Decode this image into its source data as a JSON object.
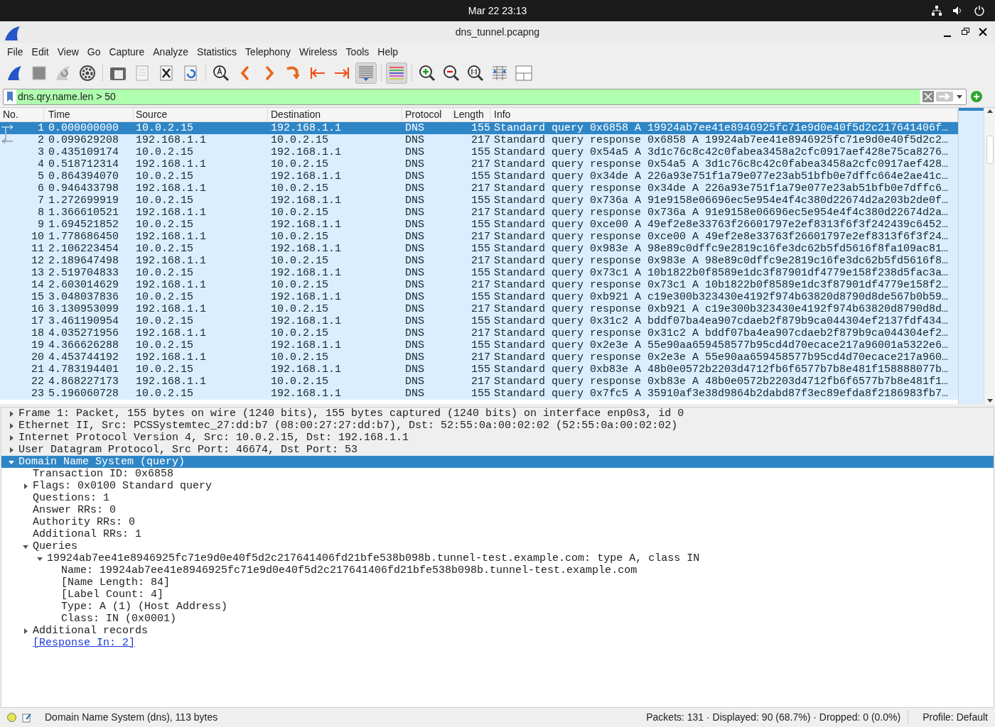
{
  "top_bar": {
    "datetime": "Mar 22  23:13"
  },
  "window": {
    "title": "dns_tunnel.pcapng"
  },
  "menu": [
    "File",
    "Edit",
    "View",
    "Go",
    "Capture",
    "Analyze",
    "Statistics",
    "Telephony",
    "Wireless",
    "Tools",
    "Help"
  ],
  "toolbar": [
    {
      "kind": "start",
      "pressed": false
    },
    {
      "kind": "stop",
      "pressed": false
    },
    {
      "kind": "restart",
      "pressed": false
    },
    {
      "kind": "options",
      "pressed": false
    },
    {
      "kind": "sep"
    },
    {
      "kind": "open",
      "pressed": false
    },
    {
      "kind": "save",
      "pressed": false
    },
    {
      "kind": "close",
      "pressed": false
    },
    {
      "kind": "reload",
      "pressed": false
    },
    {
      "kind": "sep"
    },
    {
      "kind": "find",
      "pressed": false
    },
    {
      "kind": "back",
      "pressed": false
    },
    {
      "kind": "forward",
      "pressed": false
    },
    {
      "kind": "goto",
      "pressed": false
    },
    {
      "kind": "first",
      "pressed": false
    },
    {
      "kind": "last",
      "pressed": false
    },
    {
      "kind": "autoscroll",
      "pressed": true
    },
    {
      "kind": "sep"
    },
    {
      "kind": "colorize",
      "pressed": true
    },
    {
      "kind": "sep"
    },
    {
      "kind": "zoom-in",
      "pressed": false
    },
    {
      "kind": "zoom-out",
      "pressed": false
    },
    {
      "kind": "zoom-normal",
      "pressed": false
    },
    {
      "kind": "resize",
      "pressed": false
    },
    {
      "kind": "layout",
      "pressed": false
    }
  ],
  "filter": {
    "value": "dns.qry.name.len > 50",
    "valid": true
  },
  "packet_list": {
    "columns": [
      "No.",
      "Time",
      "Source",
      "Destination",
      "Protocol",
      "Length",
      "Info"
    ],
    "rows": [
      {
        "no": "1",
        "time": "0.000000000",
        "source": "10.0.2.15",
        "destination": "192.168.1.1",
        "protocol": "DNS",
        "length": "155",
        "info": "Standard query 0x6858 A 19924ab7ee41e8946925fc71e9d0e40f5d2c217641406f…",
        "selected": true,
        "kind": "request"
      },
      {
        "no": "2",
        "time": "0.099629208",
        "source": "192.168.1.1",
        "destination": "10.0.2.15",
        "protocol": "DNS",
        "length": "217",
        "info": "Standard query response 0x6858 A 19924ab7ee41e8946925fc71e9d0e40f5d2c2…",
        "selected": false,
        "kind": "response"
      },
      {
        "no": "3",
        "time": "0.435109174",
        "source": "10.0.2.15",
        "destination": "192.168.1.1",
        "protocol": "DNS",
        "length": "155",
        "info": "Standard query 0x54a5 A 3d1c76c8c42c0fabea3458a2cfc0917aef428e75ca8276…",
        "selected": false
      },
      {
        "no": "4",
        "time": "0.518712314",
        "source": "192.168.1.1",
        "destination": "10.0.2.15",
        "protocol": "DNS",
        "length": "217",
        "info": "Standard query response 0x54a5 A 3d1c76c8c42c0fabea3458a2cfc0917aef428…",
        "selected": false
      },
      {
        "no": "5",
        "time": "0.864394070",
        "source": "10.0.2.15",
        "destination": "192.168.1.1",
        "protocol": "DNS",
        "length": "155",
        "info": "Standard query 0x34de A 226a93e751f1a79e077e23ab51bfb0e7dffc664e2ae41c…",
        "selected": false
      },
      {
        "no": "6",
        "time": "0.946433798",
        "source": "192.168.1.1",
        "destination": "10.0.2.15",
        "protocol": "DNS",
        "length": "217",
        "info": "Standard query response 0x34de A 226a93e751f1a79e077e23ab51bfb0e7dffc6…",
        "selected": false
      },
      {
        "no": "7",
        "time": "1.272699919",
        "source": "10.0.2.15",
        "destination": "192.168.1.1",
        "protocol": "DNS",
        "length": "155",
        "info": "Standard query 0x736a A 91e9158e06696ec5e954e4f4c380d22674d2a203b2de0f…",
        "selected": false
      },
      {
        "no": "8",
        "time": "1.366610521",
        "source": "192.168.1.1",
        "destination": "10.0.2.15",
        "protocol": "DNS",
        "length": "217",
        "info": "Standard query response 0x736a A 91e9158e06696ec5e954e4f4c380d22674d2a…",
        "selected": false
      },
      {
        "no": "9",
        "time": "1.694521852",
        "source": "10.0.2.15",
        "destination": "192.168.1.1",
        "protocol": "DNS",
        "length": "155",
        "info": "Standard query 0xce00 A 49ef2e8e33763f26601797e2ef8313f6f3f242439c6452…",
        "selected": false
      },
      {
        "no": "10",
        "time": "1.778686450",
        "source": "192.168.1.1",
        "destination": "10.0.2.15",
        "protocol": "DNS",
        "length": "217",
        "info": "Standard query response 0xce00 A 49ef2e8e33763f26601797e2ef8313f6f3f24…",
        "selected": false
      },
      {
        "no": "11",
        "time": "2.106223454",
        "source": "10.0.2.15",
        "destination": "192.168.1.1",
        "protocol": "DNS",
        "length": "155",
        "info": "Standard query 0x983e A 98e89c0dffc9e2819c16fe3dc62b5fd5616f8fa109ac81…",
        "selected": false
      },
      {
        "no": "12",
        "time": "2.189647498",
        "source": "192.168.1.1",
        "destination": "10.0.2.15",
        "protocol": "DNS",
        "length": "217",
        "info": "Standard query response 0x983e A 98e89c0dffc9e2819c16fe3dc62b5fd5616f8…",
        "selected": false
      },
      {
        "no": "13",
        "time": "2.519704833",
        "source": "10.0.2.15",
        "destination": "192.168.1.1",
        "protocol": "DNS",
        "length": "155",
        "info": "Standard query 0x73c1 A 10b1822b0f8589e1dc3f87901df4779e158f238d5fac3a…",
        "selected": false
      },
      {
        "no": "14",
        "time": "2.603014629",
        "source": "192.168.1.1",
        "destination": "10.0.2.15",
        "protocol": "DNS",
        "length": "217",
        "info": "Standard query response 0x73c1 A 10b1822b0f8589e1dc3f87901df4779e158f2…",
        "selected": false
      },
      {
        "no": "15",
        "time": "3.048037836",
        "source": "10.0.2.15",
        "destination": "192.168.1.1",
        "protocol": "DNS",
        "length": "155",
        "info": "Standard query 0xb921 A c19e300b323430e4192f974b63820d8790d8de567b0b59…",
        "selected": false
      },
      {
        "no": "16",
        "time": "3.130953099",
        "source": "192.168.1.1",
        "destination": "10.0.2.15",
        "protocol": "DNS",
        "length": "217",
        "info": "Standard query response 0xb921 A c19e300b323430e4192f974b63820d8790d8d…",
        "selected": false
      },
      {
        "no": "17",
        "time": "3.461190954",
        "source": "10.0.2.15",
        "destination": "192.168.1.1",
        "protocol": "DNS",
        "length": "155",
        "info": "Standard query 0x31c2 A bddf07ba4ea907cdaeb2f879b9ca044304ef2137fdf434…",
        "selected": false
      },
      {
        "no": "18",
        "time": "4.035271956",
        "source": "192.168.1.1",
        "destination": "10.0.2.15",
        "protocol": "DNS",
        "length": "217",
        "info": "Standard query response 0x31c2 A bddf07ba4ea907cdaeb2f879b9ca044304ef2…",
        "selected": false
      },
      {
        "no": "19",
        "time": "4.366626288",
        "source": "10.0.2.15",
        "destination": "192.168.1.1",
        "protocol": "DNS",
        "length": "155",
        "info": "Standard query 0x2e3e A 55e90aa659458577b95cd4d70ecace217a96001a5322e6…",
        "selected": false
      },
      {
        "no": "20",
        "time": "4.453744192",
        "source": "192.168.1.1",
        "destination": "10.0.2.15",
        "protocol": "DNS",
        "length": "217",
        "info": "Standard query response 0x2e3e A 55e90aa659458577b95cd4d70ecace217a960…",
        "selected": false
      },
      {
        "no": "21",
        "time": "4.783194401",
        "source": "10.0.2.15",
        "destination": "192.168.1.1",
        "protocol": "DNS",
        "length": "155",
        "info": "Standard query 0xb83e A 48b0e0572b2203d4712fb6f6577b7b8e481f158888077b…",
        "selected": false
      },
      {
        "no": "22",
        "time": "4.868227173",
        "source": "192.168.1.1",
        "destination": "10.0.2.15",
        "protocol": "DNS",
        "length": "217",
        "info": "Standard query response 0xb83e A 48b0e0572b2203d4712fb6f6577b7b8e481f1…",
        "selected": false
      },
      {
        "no": "23",
        "time": "5.196060728",
        "source": "10.0.2.15",
        "destination": "192.168.1.1",
        "protocol": "DNS",
        "length": "155",
        "info": "Standard query 0x7fc5 A 35910af3e38d9864b2dabd87f3ec89efda8f2186983fb7…",
        "selected": false
      }
    ]
  },
  "details": [
    {
      "label": "Frame 1: Packet, 155 bytes on wire (1240 bits), 155 bytes captured (1240 bits) on interface enp0s3, id 0",
      "expanded": false,
      "selected": false
    },
    {
      "label": "Ethernet II, Src: PCSSystemtec_27:dd:b7 (08:00:27:27:dd:b7), Dst: 52:55:0a:00:02:02 (52:55:0a:00:02:02)",
      "expanded": false,
      "selected": false
    },
    {
      "label": "Internet Protocol Version 4, Src: 10.0.2.15, Dst: 192.168.1.1",
      "expanded": false,
      "selected": false
    },
    {
      "label": "User Datagram Protocol, Src Port: 46674, Dst Port: 53",
      "expanded": false,
      "selected": false
    },
    {
      "label": "Domain Name System (query)",
      "expanded": true,
      "selected": true,
      "children": [
        {
          "label": "Transaction ID: 0x6858",
          "selected": false
        },
        {
          "label": "Flags: 0x0100 Standard query",
          "expanded": false,
          "selected": false
        },
        {
          "label": "Questions: 1",
          "selected": false
        },
        {
          "label": "Answer RRs: 0",
          "selected": false
        },
        {
          "label": "Authority RRs: 0",
          "selected": false
        },
        {
          "label": "Additional RRs: 1",
          "selected": false
        },
        {
          "label": "Queries",
          "expanded": true,
          "selected": false,
          "children": [
            {
              "label": "19924ab7ee41e8946925fc71e9d0e40f5d2c217641406fd21bfe538b098b.tunnel-test.example.com: type A, class IN",
              "expanded": true,
              "selected": false,
              "children": [
                {
                  "label": "Name: 19924ab7ee41e8946925fc71e9d0e40f5d2c217641406fd21bfe538b098b.tunnel-test.example.com",
                  "selected": false
                },
                {
                  "label": "[Name Length: 84]",
                  "selected": false
                },
                {
                  "label": "[Label Count: 4]",
                  "selected": false
                },
                {
                  "label": "Type: A (1) (Host Address)",
                  "selected": false
                },
                {
                  "label": "Class: IN (0x0001)",
                  "selected": false
                }
              ]
            }
          ]
        },
        {
          "label": "Additional records",
          "expanded": false,
          "selected": false
        },
        {
          "label": "[Response In: 2]",
          "kind": "link",
          "selected": false
        }
      ]
    }
  ],
  "status_bar": {
    "message": "Domain Name System (dns), 113 bytes",
    "stats": "Packets: 131 · Displayed: 90 (68.7%) · Dropped: 0 (0.0%)",
    "profile": "Profile: Default"
  }
}
